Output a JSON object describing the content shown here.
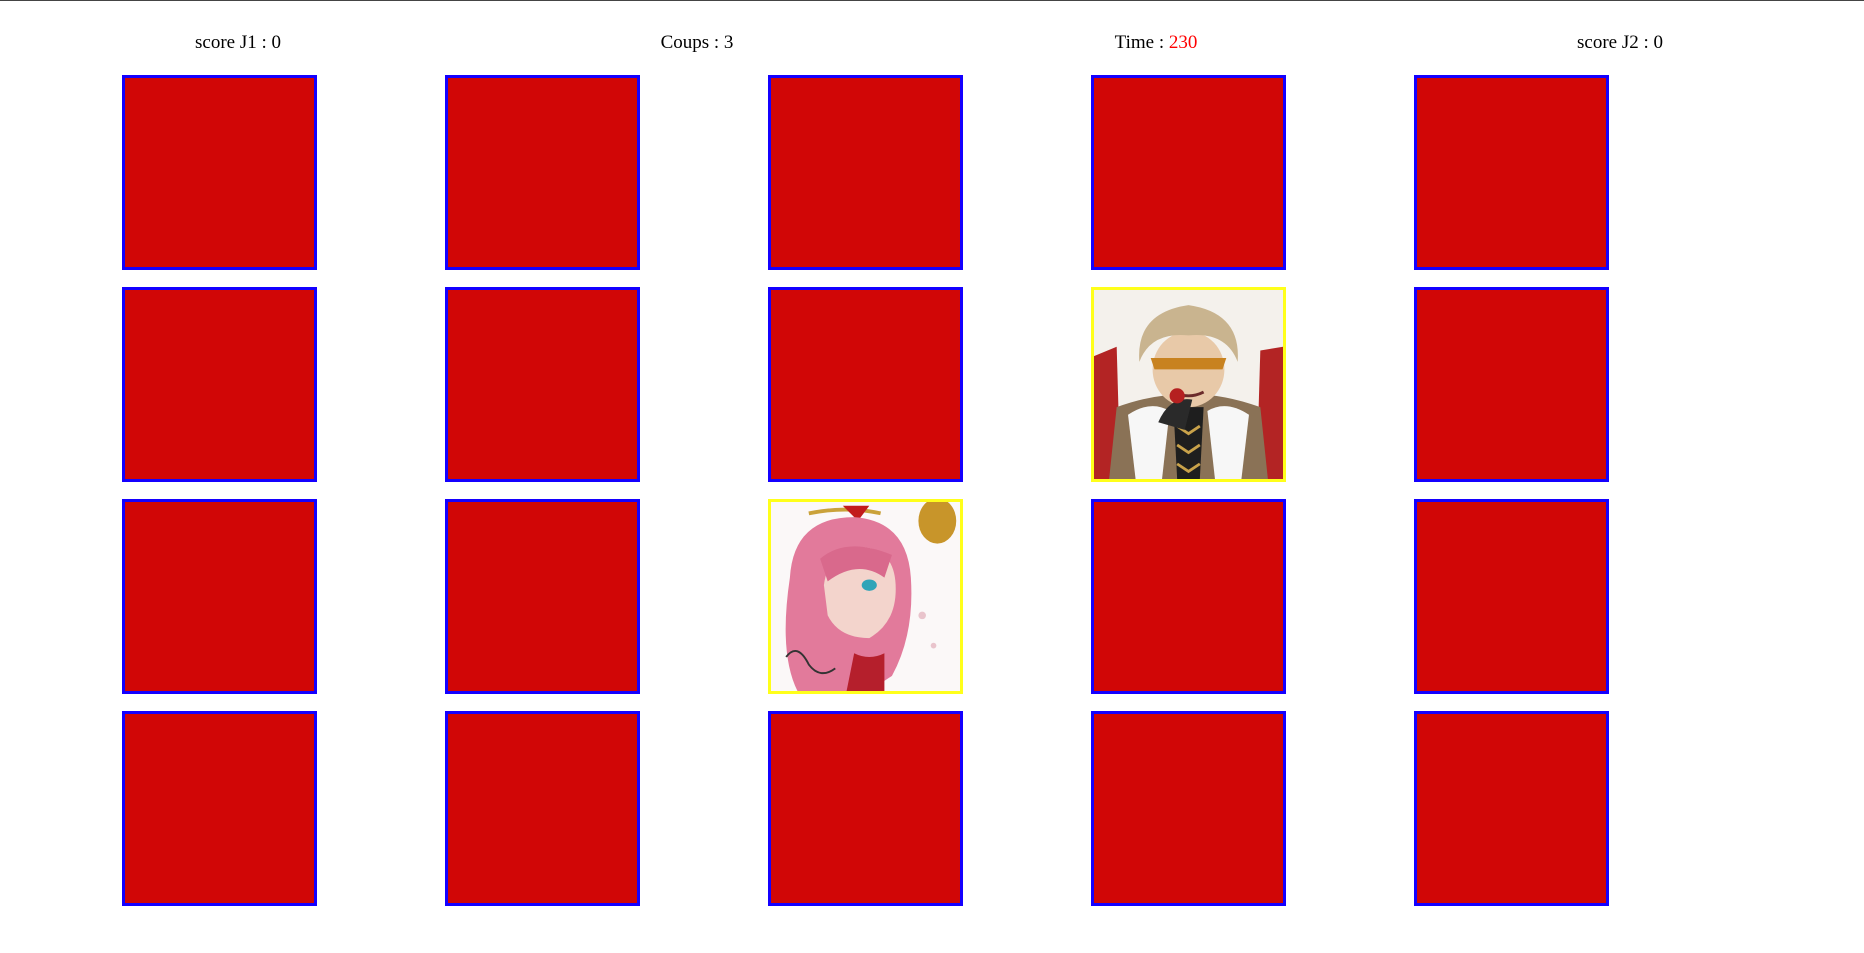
{
  "header": {
    "score_j1_label": "score J1 : ",
    "score_j1": "0",
    "coups_label": "Coups : ",
    "coups": "3",
    "time_label": "Time : ",
    "time": "230",
    "score_j2_label": "score J2 : ",
    "score_j2": "0"
  },
  "colors": {
    "card_back": "#d10606",
    "card_border": "#1400ff",
    "revealed_border": "#ffff1a",
    "time_value": "#ff0000"
  },
  "board": {
    "rows": 4,
    "cols": 5,
    "revealed": [
      {
        "row": 2,
        "col": 4,
        "icon": "hooded-blond-character-icon"
      },
      {
        "row": 3,
        "col": 3,
        "icon": "pink-haired-character-icon"
      }
    ]
  }
}
